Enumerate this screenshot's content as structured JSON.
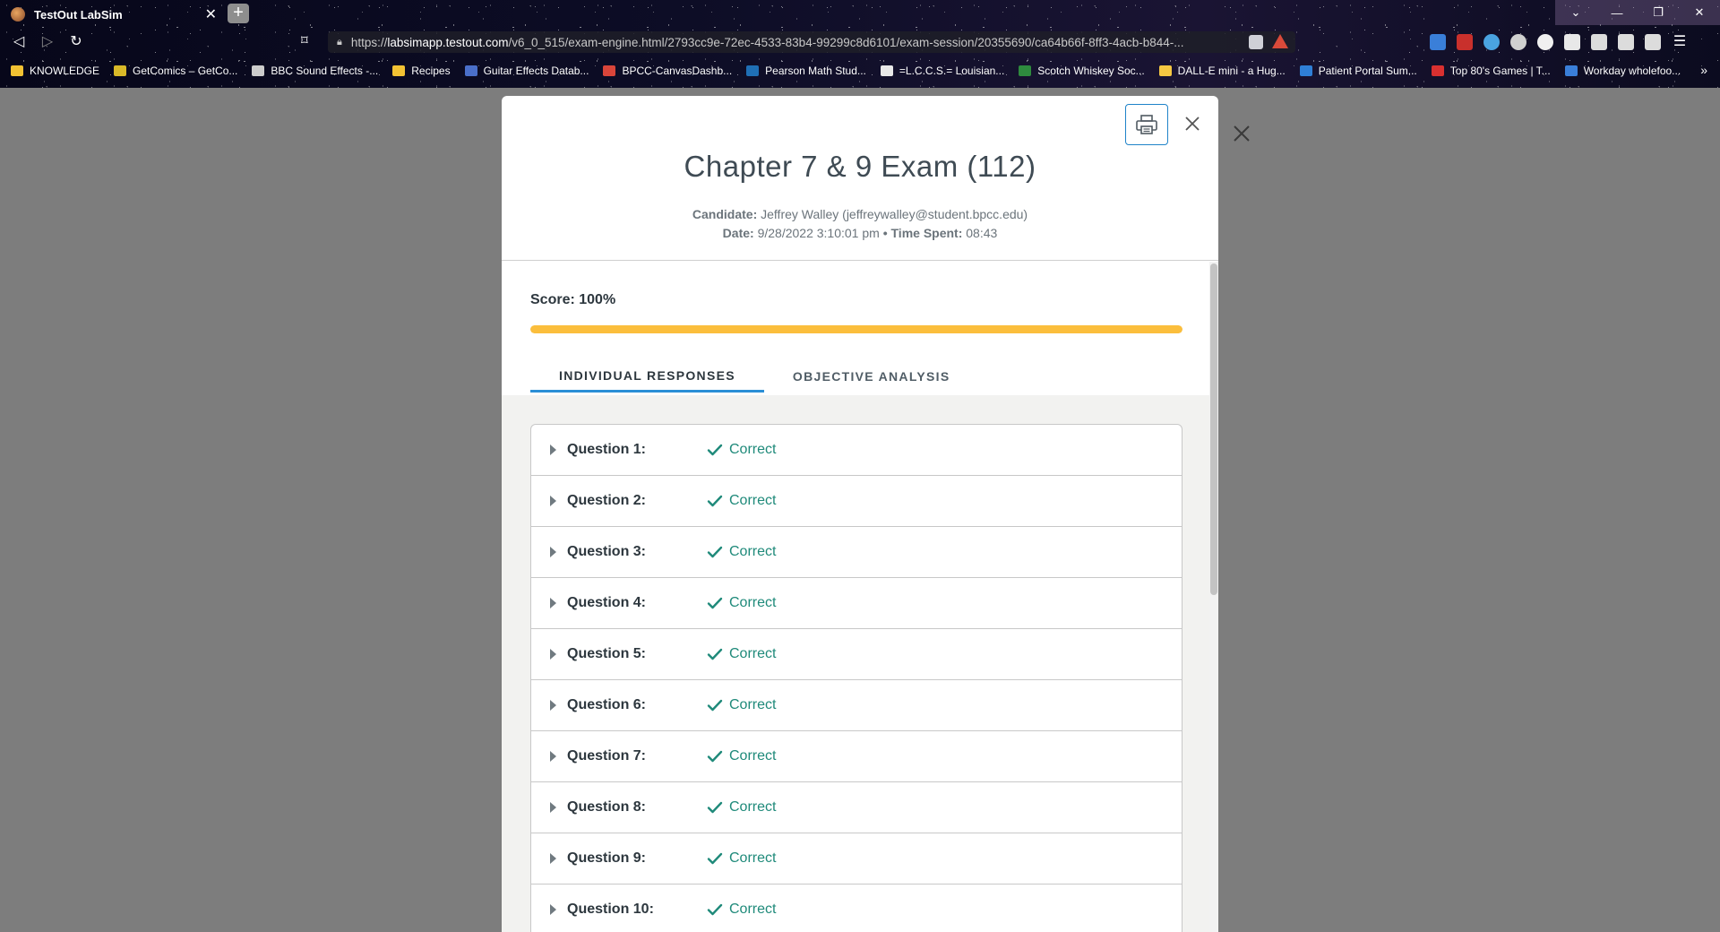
{
  "browser": {
    "tab_title": "TestOut LabSim",
    "tab_close": "✕",
    "new_tab": "+",
    "url_host": "labsimapp.testout.com",
    "url_prefix": "https://",
    "url_path": "/v6_0_515/exam-engine.html/2793cc9e-72ec-4533-83b4-99299c8d6101/exam-session/20355690/ca64b66f-8ff3-4acb-b844-...",
    "bookmarks": [
      {
        "label": "KNOWLEDGE",
        "color": "#f2c233"
      },
      {
        "label": "GetComics – GetCo...",
        "color": "#d9b928"
      },
      {
        "label": "BBC Sound Effects -...",
        "color": "#cccccc"
      },
      {
        "label": "Recipes",
        "color": "#f2c233"
      },
      {
        "label": "Guitar Effects Datab...",
        "color": "#4a6fc9"
      },
      {
        "label": "BPCC-CanvasDashb...",
        "color": "#d9453a"
      },
      {
        "label": "Pearson Math Stud...",
        "color": "#1f6fb5"
      },
      {
        "label": "=L.C.C.S.= Louisian...",
        "color": "#e8e8e8"
      },
      {
        "label": "Scotch Whiskey Soc...",
        "color": "#2e8b3e"
      },
      {
        "label": "DALL-E mini - a Hug...",
        "color": "#f5c842"
      },
      {
        "label": "Patient Portal Sum...",
        "color": "#2f7fd6"
      },
      {
        "label": "Top 80's Games | T...",
        "color": "#d93030"
      },
      {
        "label": "Workday wholefoo...",
        "color": "#3a7fd9"
      }
    ],
    "bookmarks_more": "»"
  },
  "exam": {
    "title": "Chapter 7 & 9 Exam (112)",
    "candidate_label": "Candidate:",
    "candidate_value": "Jeffrey Walley  (jeffreywalley@student.bpcc.edu)",
    "date_label": "Date:",
    "date_value": "9/28/2022 3:10:01 pm",
    "separator": "•",
    "time_label": "Time Spent:",
    "time_value": "08:43",
    "score_text": "Score: 100%",
    "score_fraction": 1.0,
    "progress_color": "#fbbe3c"
  },
  "tabs": [
    {
      "label": "INDIVIDUAL RESPONSES",
      "active": true
    },
    {
      "label": "OBJECTIVE ANALYSIS",
      "active": false
    }
  ],
  "questions": [
    {
      "label": "Question 1:",
      "status": "Correct"
    },
    {
      "label": "Question 2:",
      "status": "Correct"
    },
    {
      "label": "Question 3:",
      "status": "Correct"
    },
    {
      "label": "Question 4:",
      "status": "Correct"
    },
    {
      "label": "Question 5:",
      "status": "Correct"
    },
    {
      "label": "Question 6:",
      "status": "Correct"
    },
    {
      "label": "Question 7:",
      "status": "Correct"
    },
    {
      "label": "Question 8:",
      "status": "Correct"
    },
    {
      "label": "Question 9:",
      "status": "Correct"
    },
    {
      "label": "Question 10:",
      "status": "Correct"
    }
  ],
  "colors": {
    "correct": "#1f8a7a",
    "accent": "#2b8fd6"
  }
}
